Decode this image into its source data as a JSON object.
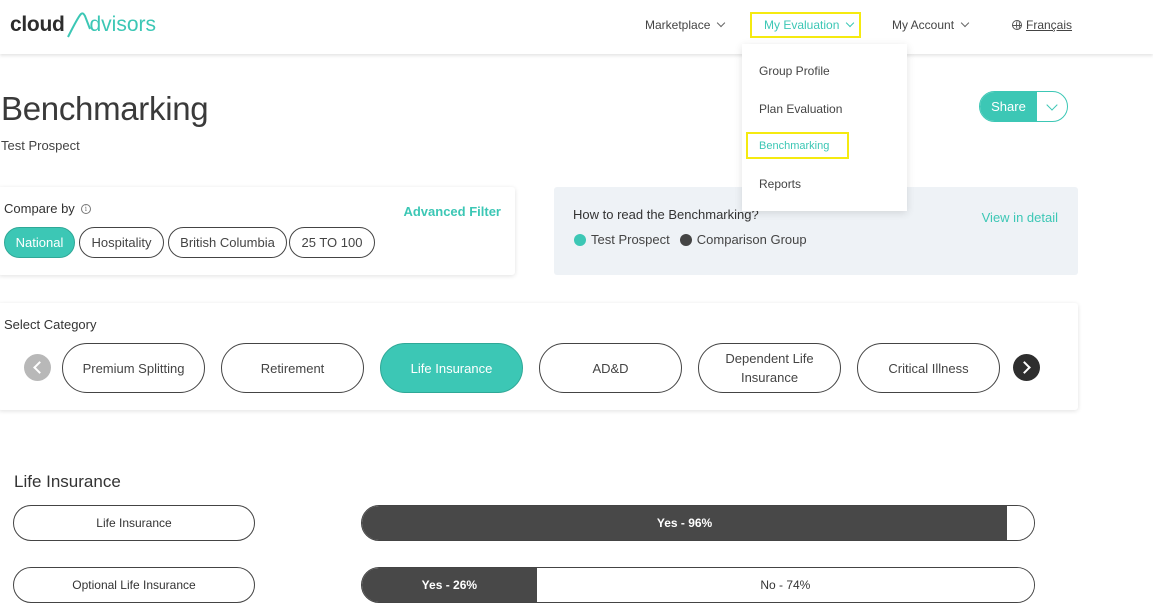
{
  "header": {
    "logo_primary": "cloud",
    "logo_secondary": "dvisors",
    "nav": {
      "marketplace": "Marketplace",
      "my_evaluation": "My Evaluation",
      "my_account": "My Account",
      "language": "Français"
    },
    "colors": {
      "accent": "#3cc7b5",
      "highlight": "#f5ea10"
    }
  },
  "dropdown": {
    "items": [
      "Group Profile",
      "Plan Evaluation",
      "Benchmarking",
      "Reports"
    ]
  },
  "page": {
    "title": "Benchmarking",
    "subtitle": "Test Prospect",
    "share_label": "Share"
  },
  "compare": {
    "label": "Compare by",
    "advanced_filter": "Advanced Filter",
    "chips": [
      "National",
      "Hospitality",
      "British Columbia",
      "25 TO 100"
    ]
  },
  "read": {
    "title": "How to read the Benchmarking?",
    "view_detail": "View in detail",
    "legend": [
      {
        "label": "Test Prospect",
        "color": "#3cc7b5"
      },
      {
        "label": "Comparison Group",
        "color": "#444444"
      }
    ]
  },
  "category": {
    "label": "Select Category",
    "items": [
      "Premium Splitting",
      "Retirement",
      "Life Insurance",
      "AD&D",
      "Dependent Life Insurance",
      "Critical Illness"
    ]
  },
  "results": {
    "title": "Life Insurance",
    "rows": [
      {
        "label": "Life Insurance",
        "yes_label": "Yes - 96%",
        "yes": 96,
        "no_label": "",
        "no": 4
      },
      {
        "label": "Optional Life Insurance",
        "yes_label": "Yes - 26%",
        "yes": 26,
        "no_label": "No - 74%",
        "no": 74
      }
    ]
  }
}
